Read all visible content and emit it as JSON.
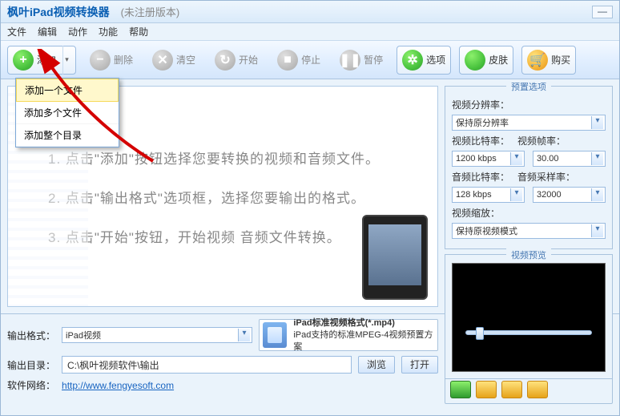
{
  "titlebar": {
    "title": "枫叶iPad视频转换器",
    "subtitle": "(未注册版本)"
  },
  "menu": {
    "file": "文件",
    "edit": "编辑",
    "action": "动作",
    "function": "功能",
    "help": "帮助"
  },
  "toolbar": {
    "add": "添加",
    "delete": "删除",
    "clear": "清空",
    "start": "开始",
    "stop": "停止",
    "pause": "暂停",
    "options": "选项",
    "skin": "皮肤",
    "buy": "购买"
  },
  "dropdown": {
    "add_one": "添加一个文件",
    "add_many": "添加多个文件",
    "add_dir": "添加整个目录"
  },
  "hints": {
    "h1": "1. 点击\"添加\"按钮选择您要转换的视频和音频文件。",
    "h2": "2. 点击\"输出格式\"选项框，选择您要输出的格式。",
    "h3": "3. 点击\"开始\"按钮，开始视频 音频文件转换。"
  },
  "preset": {
    "legend": "预置选项",
    "res_label": "视频分辨率：",
    "res_value": "保持原分辨率",
    "vbit_label": "视频比特率：",
    "vbit_value": "1200 kbps",
    "vfps_label": "视频帧率：",
    "vfps_value": "30.00",
    "abit_label": "音频比特率：",
    "abit_value": "128 kbps",
    "asr_label": "音频采样率：",
    "asr_value": "32000",
    "scale_label": "视频缩放：",
    "scale_value": "保持原视频模式"
  },
  "preview": {
    "legend": "视频预览"
  },
  "output": {
    "format_label": "输出格式：",
    "format_value": "iPad视频",
    "format_title": "iPad标准视频格式(*.mp4)",
    "format_desc": "iPad支持的标准MPEG-4视频预置方案",
    "dir_label": "输出目录：",
    "dir_value": "C:\\枫叶视频软件\\输出",
    "browse": "浏览",
    "open": "打开",
    "site_label": "软件网络：",
    "site_url": "http://www.fengyesoft.com"
  }
}
